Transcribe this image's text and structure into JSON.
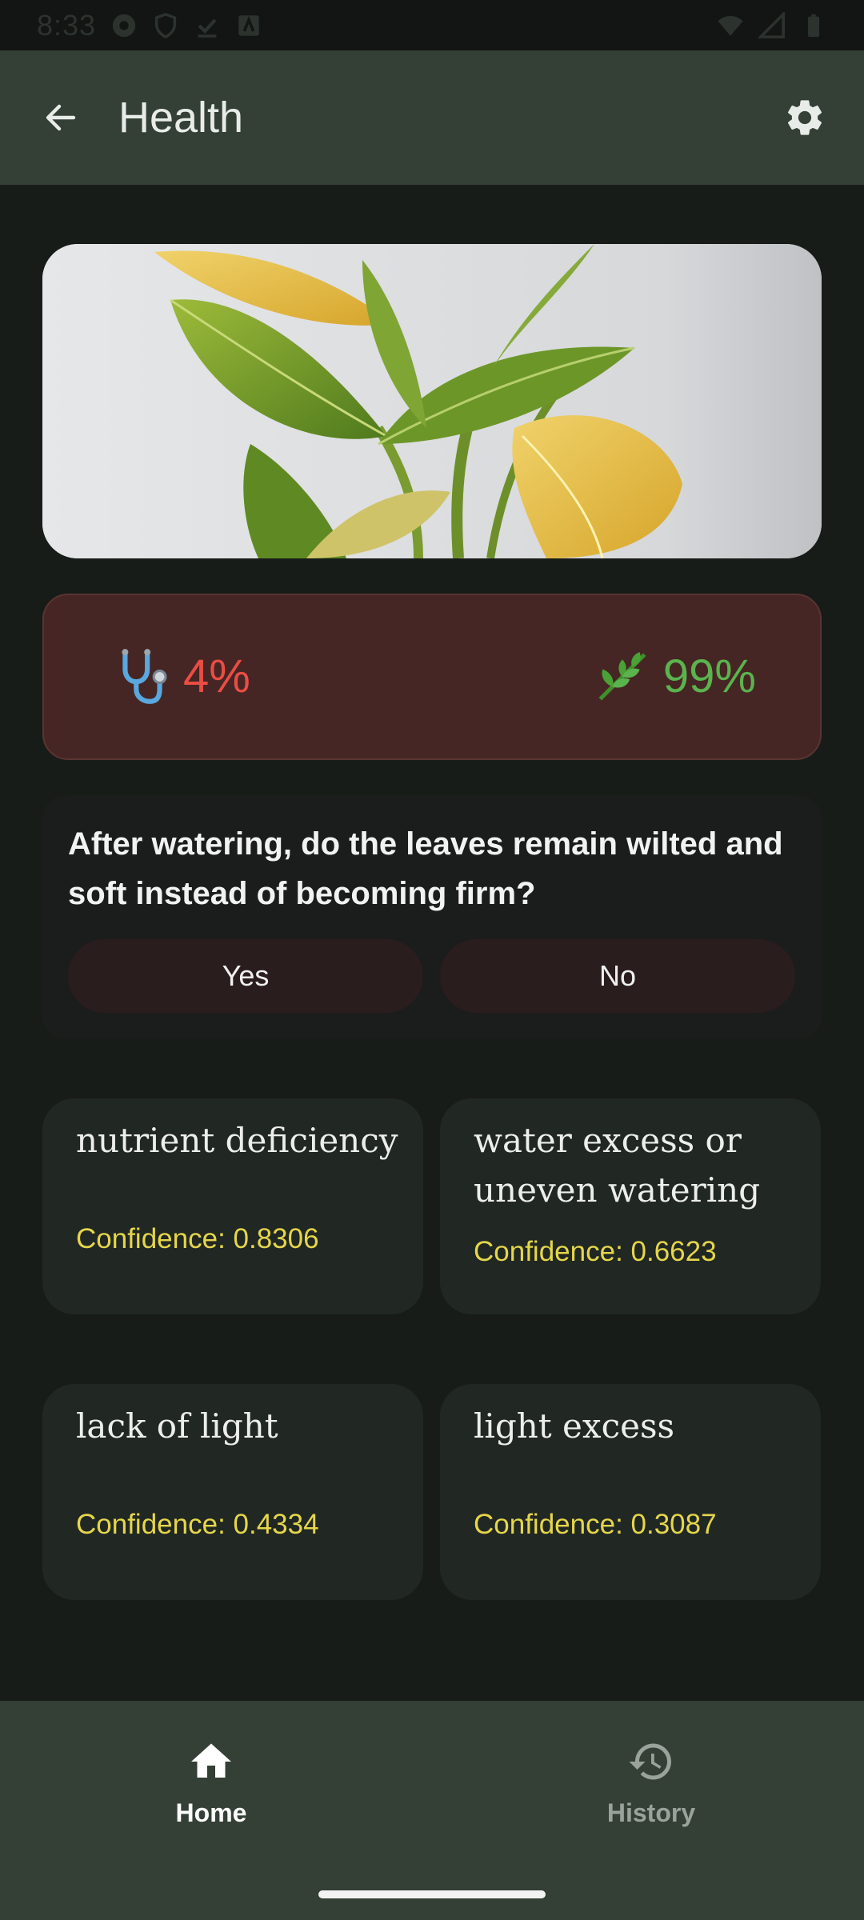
{
  "status_bar": {
    "time": "8:33"
  },
  "app_bar": {
    "title": "Health"
  },
  "stats": {
    "disease_value": "4%",
    "health_value": "99%"
  },
  "question": {
    "text": "After watering, do the leaves remain wilted and soft instead of becoming firm?",
    "yes_label": "Yes",
    "no_label": "No"
  },
  "diagnoses": [
    {
      "name": "nutrient deficiency",
      "confidence": "Confidence: 0.8306"
    },
    {
      "name": "water excess or uneven watering",
      "confidence": "Confidence: 0.6623"
    },
    {
      "name": "lack of light",
      "confidence": "Confidence: 0.4334"
    },
    {
      "name": "light excess",
      "confidence": "Confidence: 0.3087"
    }
  ],
  "bottom_nav": {
    "home_label": "Home",
    "history_label": "History"
  },
  "colors": {
    "app_bar": "#343f36",
    "background": "#171c19",
    "disease": "#ea4d44",
    "health": "#5bb34e",
    "confidence": "#e5d64b"
  }
}
